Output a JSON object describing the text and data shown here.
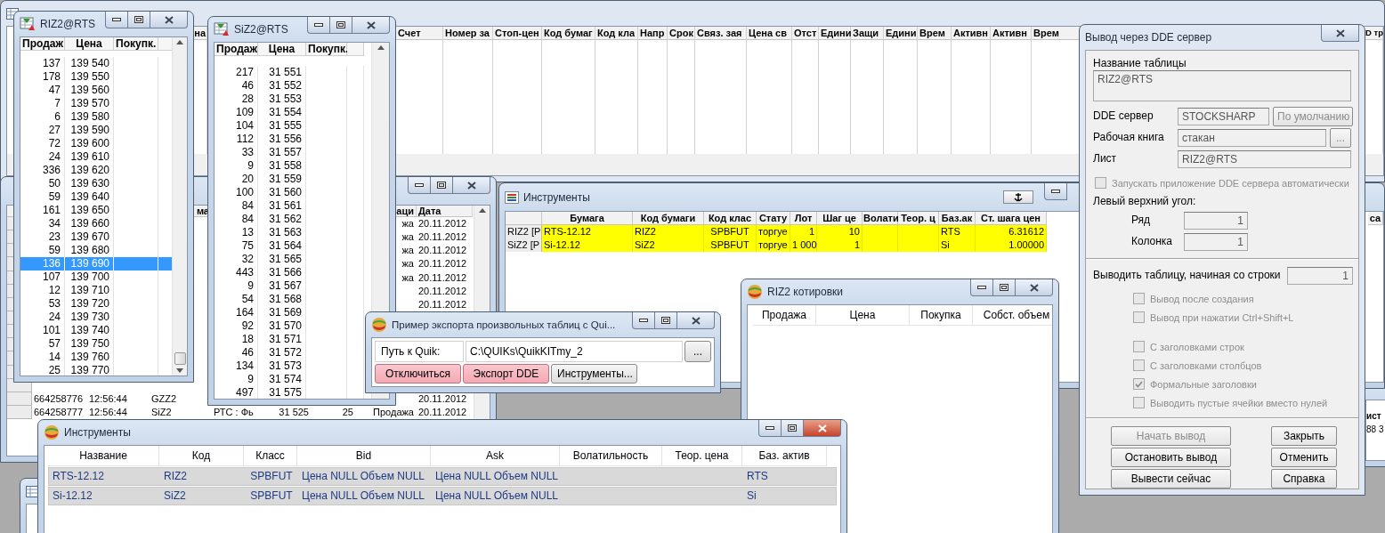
{
  "orders_window": {
    "column_left": "на",
    "columns": [
      "Счет",
      "Номер за",
      "Стоп-цен",
      "Код бумаг",
      "Код кла",
      "Напр",
      "Срок",
      "Связ. зая",
      "Цена св",
      "Отст",
      "Едини",
      "Защи",
      "Едини",
      "Врем",
      "Активн",
      "Активн",
      "Врем"
    ],
    "column_far_right": "D тр"
  },
  "trades_window": {
    "header": {
      "code": "ма",
      "operation": "аци",
      "date": "Дата"
    },
    "rows": [
      {
        "operation": "жа",
        "date": "20.11.2012"
      },
      {
        "operation": "жа",
        "date": "20.11.2012"
      },
      {
        "operation": "жа",
        "date": "20.11.2012"
      },
      {
        "operation": "жа",
        "date": "20.11.2012"
      },
      {
        "operation": "жа",
        "date": "20.11.2012"
      },
      {
        "date": "20.11.2012"
      },
      {
        "date": "20.11.2012"
      },
      {},
      {},
      {},
      {},
      {},
      {},
      {
        "id": "664258776",
        "time": "12:56:44",
        "code": "GZZ2",
        "date": "20.11.2012"
      },
      {
        "id": "664258777",
        "time": "12:56:44",
        "code": "SiZ2",
        "exchange": "РТС : Фь",
        "price": "31 525",
        "quantity": "25",
        "operation": "Продажа",
        "date": "20.11.2012"
      }
    ]
  },
  "quik_instruments_window": {
    "title": "Инструменты",
    "columns": [
      "Бумага",
      "Код бумаги",
      "Код клас",
      "Стату",
      "Лот",
      "Шаг це",
      "Волати",
      "Теор. ц",
      "Баз.ак",
      "Ст. шага цен"
    ],
    "column_far_right": "са",
    "rows": [
      {
        "row_header": "RIZ2 [Р",
        "security": "RTS-12.12",
        "code": "RIZ2",
        "class": "SPBFUT",
        "status": "торгуе",
        "lot": "1",
        "step": "10",
        "base": "RTS",
        "step_price": "6.31612"
      },
      {
        "row_header": "SiZ2 [Р",
        "security": "Si-12.12",
        "code": "SiZ2",
        "class": "SPBFUT",
        "status": "торгуе",
        "lot": "1 000",
        "step": "1",
        "base": "Si",
        "step_price": "1.00000"
      }
    ]
  },
  "right_window": {
    "header": "ист",
    "value": "88 3"
  },
  "book_riz2": {
    "title": "RIZ2@RTS",
    "columns": [
      "Продаж",
      "Цена",
      "Покупк."
    ],
    "rows": [
      {
        "sell": "137",
        "price": "139 540",
        "selected": false
      },
      {
        "sell": "178",
        "price": "139 550",
        "selected": false
      },
      {
        "sell": "47",
        "price": "139 560",
        "selected": false
      },
      {
        "sell": "7",
        "price": "139 570",
        "selected": false
      },
      {
        "sell": "6",
        "price": "139 580",
        "selected": false
      },
      {
        "sell": "27",
        "price": "139 590",
        "selected": false
      },
      {
        "sell": "72",
        "price": "139 600",
        "selected": false
      },
      {
        "sell": "24",
        "price": "139 610",
        "selected": false
      },
      {
        "sell": "336",
        "price": "139 620",
        "selected": false
      },
      {
        "sell": "50",
        "price": "139 630",
        "selected": false
      },
      {
        "sell": "59",
        "price": "139 640",
        "selected": false
      },
      {
        "sell": "161",
        "price": "139 650",
        "selected": false
      },
      {
        "sell": "34",
        "price": "139 660",
        "selected": false
      },
      {
        "sell": "23",
        "price": "139 670",
        "selected": false
      },
      {
        "sell": "59",
        "price": "139 680",
        "selected": false
      },
      {
        "sell": "136",
        "price": "139 690",
        "selected": true
      },
      {
        "sell": "107",
        "price": "139 700",
        "selected": false
      },
      {
        "sell": "12",
        "price": "139 710",
        "selected": false
      },
      {
        "sell": "53",
        "price": "139 720",
        "selected": false
      },
      {
        "sell": "24",
        "price": "139 730",
        "selected": false
      },
      {
        "sell": "101",
        "price": "139 740",
        "selected": false
      },
      {
        "sell": "57",
        "price": "139 750",
        "selected": false
      },
      {
        "sell": "14",
        "price": "139 760",
        "selected": false
      },
      {
        "sell": "25",
        "price": "139 770",
        "selected": false
      }
    ]
  },
  "book_siz2": {
    "title": "SiZ2@RTS",
    "columns": [
      "Продаж",
      "Цена",
      "Покупк."
    ],
    "rows": [
      {
        "sell": "217",
        "price": "31 551",
        "selected": false
      },
      {
        "sell": "46",
        "price": "31 552",
        "selected": false
      },
      {
        "sell": "28",
        "price": "31 553",
        "selected": false
      },
      {
        "sell": "109",
        "price": "31 554",
        "selected": false
      },
      {
        "sell": "104",
        "price": "31 555",
        "selected": false
      },
      {
        "sell": "112",
        "price": "31 556",
        "selected": false
      },
      {
        "sell": "33",
        "price": "31 557",
        "selected": false
      },
      {
        "sell": "9",
        "price": "31 558",
        "selected": false
      },
      {
        "sell": "20",
        "price": "31 559",
        "selected": false
      },
      {
        "sell": "100",
        "price": "31 560",
        "selected": false
      },
      {
        "sell": "84",
        "price": "31 561",
        "selected": false
      },
      {
        "sell": "84",
        "price": "31 562",
        "selected": false
      },
      {
        "sell": "13",
        "price": "31 563",
        "selected": false
      },
      {
        "sell": "75",
        "price": "31 564",
        "selected": false
      },
      {
        "sell": "32",
        "price": "31 565",
        "selected": false
      },
      {
        "sell": "443",
        "price": "31 566",
        "selected": false
      },
      {
        "sell": "9",
        "price": "31 567",
        "selected": false
      },
      {
        "sell": "54",
        "price": "31 568",
        "selected": false
      },
      {
        "sell": "164",
        "price": "31 569",
        "selected": false
      },
      {
        "sell": "92",
        "price": "31 570",
        "selected": false
      },
      {
        "sell": "18",
        "price": "31 571",
        "selected": false
      },
      {
        "sell": "46",
        "price": "31 572",
        "selected": false
      },
      {
        "sell": "134",
        "price": "31 573",
        "selected": false
      },
      {
        "sell": "9",
        "price": "31 574",
        "selected": false
      },
      {
        "sell": "497",
        "price": "31 575",
        "selected": false
      }
    ]
  },
  "export_window": {
    "title": "Пример экспорта произвольных таблиц с Qui...",
    "active": false,
    "path_label": "Путь к Quik:",
    "path_value": "C:\\QUIKs\\QuikKITmy_2",
    "browse_button": "...",
    "buttons": [
      {
        "label": "Отключиться",
        "highlighted": true
      },
      {
        "label": "Экспорт DDE",
        "highlighted": true
      },
      {
        "label": "Инструменты...",
        "highlighted": false
      }
    ]
  },
  "quotes_window": {
    "title": "RIZ2 котировки",
    "active": false,
    "columns": [
      "Продажа",
      "Цена",
      "Покупка",
      "Собст. объем"
    ]
  },
  "instruments_window": {
    "title": "Инструменты",
    "active": true,
    "columns": [
      "Название",
      "Код",
      "Класс",
      "Bid",
      "Ask",
      "Волатильность",
      "Теор. цена",
      "Баз. актив"
    ],
    "rows": [
      {
        "name": "RTS-12.12",
        "code": "RIZ2",
        "class": "SPBFUT",
        "bid": "Цена NULL Объем NULL",
        "ask": "Цена NULL Объем NULL",
        "base": "RTS"
      },
      {
        "name": "Si-12.12",
        "code": "SiZ2",
        "class": "SPBFUT",
        "bid": "Цена NULL Объем NULL",
        "ask": "Цена NULL Объем NULL",
        "base": "Si"
      }
    ]
  },
  "dde_dialog": {
    "title": "Вывод через DDE сервер",
    "table_name": {
      "label": "Название таблицы",
      "value": "RIZ2@RTS",
      "disabled": true
    },
    "server": {
      "label": "DDE сервер",
      "value": "STOCKSHARP",
      "disabled": true,
      "button": {
        "label": "По умолчанию",
        "disabled": true
      }
    },
    "workbook": {
      "label": "Рабочая книга",
      "value": "стакан",
      "disabled": true,
      "button": {
        "label": "...",
        "disabled": true
      }
    },
    "sheet": {
      "label": "Лист",
      "value": "RIZ2@RTS",
      "disabled": true
    },
    "autostart": {
      "label": "Запускать приложение DDE сервера автоматически",
      "checked": false,
      "disabled": true
    },
    "corner_label": "Левый верхний угол:",
    "corner_row": {
      "label": "Ряд",
      "value": "1",
      "disabled": true
    },
    "corner_column": {
      "label": "Колонка",
      "value": "1",
      "disabled": true
    },
    "start_row": {
      "label": "Выводить таблицу,  начиная со строки",
      "value": "1",
      "disabled": true
    },
    "output_options": [
      {
        "label": "Вывод после создания",
        "checked": false,
        "disabled": true
      },
      {
        "label": "Вывод при нажатии Ctrl+Shift+L",
        "checked": false,
        "disabled": true
      }
    ],
    "format_options": [
      {
        "label": "С заголовками строк",
        "checked": false,
        "disabled": true
      },
      {
        "label": "С заголовками столбцов",
        "checked": false,
        "disabled": true
      },
      {
        "label": "Формальные заголовки",
        "checked": true,
        "disabled": true
      },
      {
        "label": "Выводить пустые ячейки вместо нулей",
        "checked": false,
        "disabled": true
      }
    ],
    "buttons_left": [
      {
        "label": "Начать вывод",
        "disabled": true
      },
      {
        "label": "Остановить вывод",
        "disabled": false
      },
      {
        "label": "Вывести сейчас",
        "disabled": false
      }
    ],
    "buttons_right": [
      {
        "label": "Закрыть",
        "disabled": false
      },
      {
        "label": "Отменить",
        "disabled": false
      },
      {
        "label": "Справка",
        "disabled": false
      }
    ]
  }
}
